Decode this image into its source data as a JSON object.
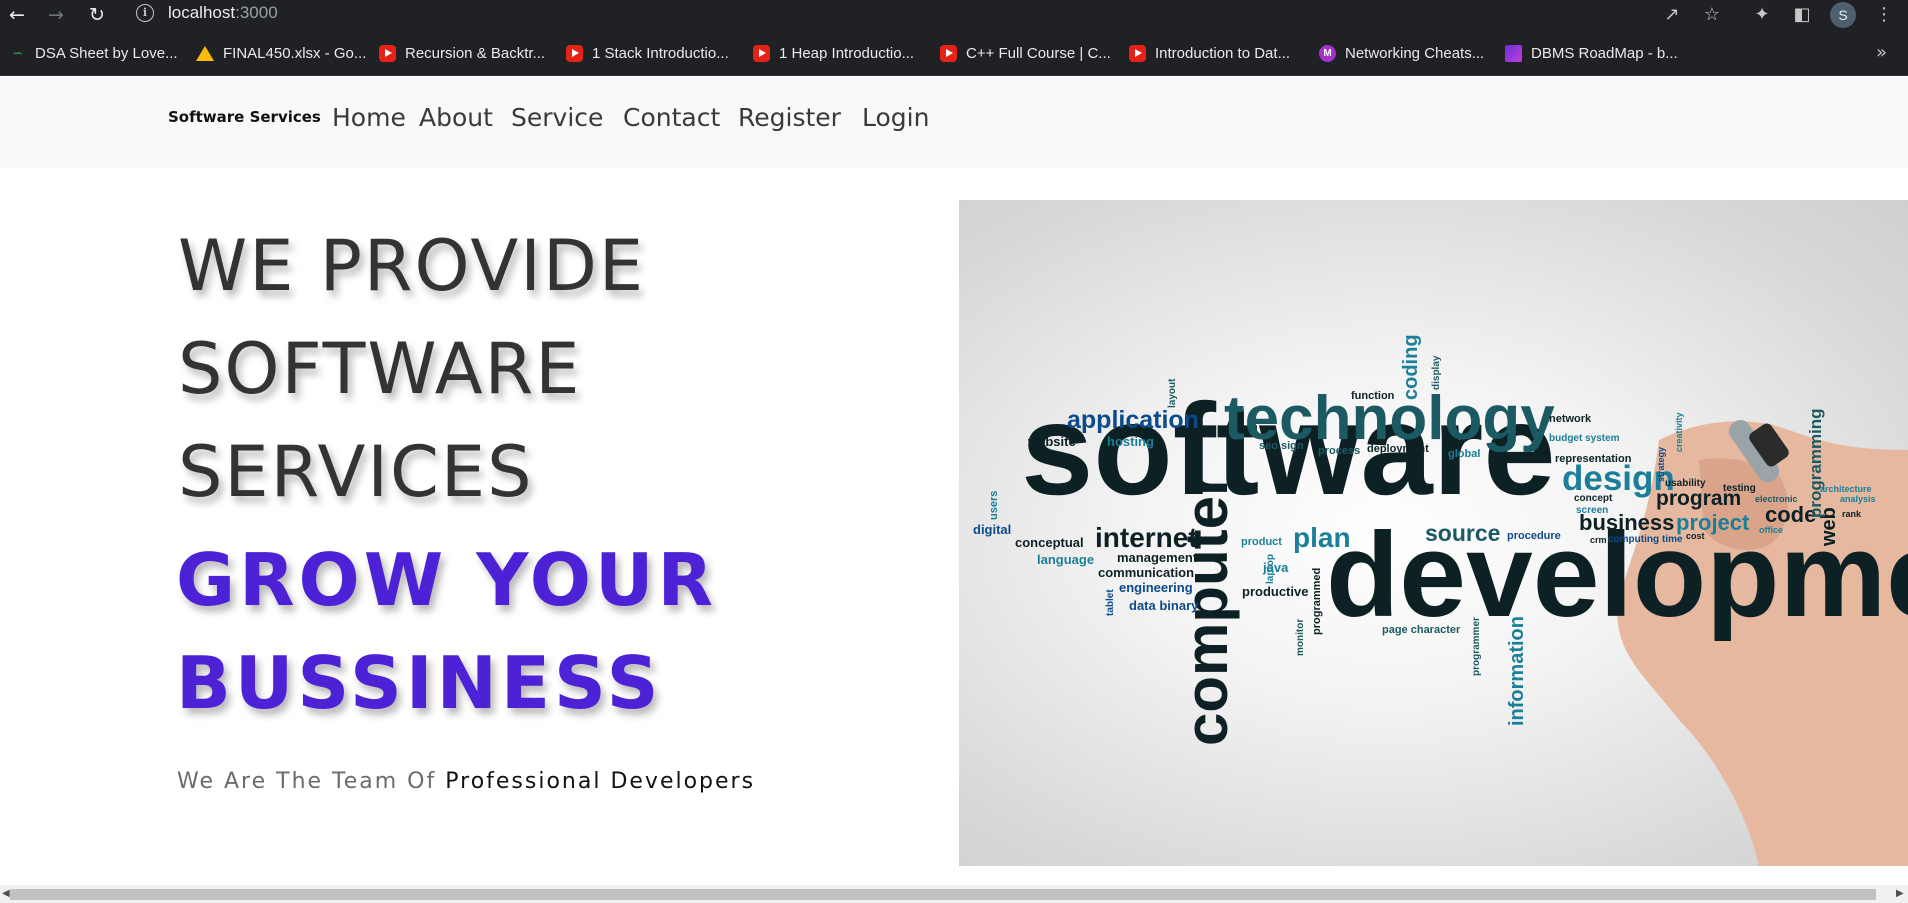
{
  "browser": {
    "url_host": "localhost",
    "url_port": ":3000",
    "profile_initial": "S",
    "bookmarks": [
      {
        "label": "DSA Sheet by Love...",
        "icon": "gfg-icon"
      },
      {
        "label": "FINAL450.xlsx - Go...",
        "icon": "google-drive-icon"
      },
      {
        "label": "Recursion & Backtr...",
        "icon": "youtube-icon"
      },
      {
        "label": "1 Stack Introductio...",
        "icon": "youtube-icon"
      },
      {
        "label": "1 Heap Introductio...",
        "icon": "youtube-icon"
      },
      {
        "label": "C++ Full Course | C...",
        "icon": "youtube-icon"
      },
      {
        "label": "Introduction to Dat...",
        "icon": "youtube-icon"
      },
      {
        "label": "Networking Cheats...",
        "icon": "medium-icon"
      },
      {
        "label": "DBMS RoadMap - b...",
        "icon": "dbms-icon"
      }
    ]
  },
  "site": {
    "brand": "Software Services",
    "nav": [
      "Home",
      "About",
      "Service",
      "Contact",
      "Register",
      "Login"
    ],
    "hero": {
      "line1": "WE PROVIDE",
      "line2": "SOFTWARE",
      "line3": "SERVICES",
      "accent1": "GROW YOUR",
      "accent2": "BUSSINESS",
      "tagline_prefix": "We Are The Team Of ",
      "tagline_strong": "Professional Developers"
    },
    "word_cloud": {
      "software": "software",
      "development": "developmen",
      "technology": "technology",
      "computer": "computer",
      "application": "application",
      "design": "design",
      "internet": "internet",
      "plan": "plan",
      "source": "source",
      "business": "business",
      "project": "project",
      "program": "program",
      "code": "code",
      "web": "web",
      "programming": "programming",
      "information": "information",
      "coding": "coding",
      "website": "website",
      "hosting": "hosting",
      "digital": "digital",
      "conceptual": "conceptual",
      "language": "language",
      "management": "management",
      "communication": "communication",
      "engineering": "engineering",
      "data_binary": "data binary",
      "productive": "productive",
      "programmed": "programmed",
      "java": "java",
      "product": "product",
      "page_character": "page character",
      "function": "function",
      "network": "network",
      "budget_system": "budget  system",
      "representation": "representation",
      "seo_sign": "seo  sign",
      "process": "process",
      "deployment": "deployment",
      "global": "global",
      "procedure": "procedure",
      "concept": "concept",
      "screen": "screen",
      "computing": "computing",
      "time": "time",
      "layout": "layout",
      "display": "display",
      "users": "users",
      "laptop": "laptop",
      "tablet": "tablet",
      "monitor": "monitor",
      "programmer": "programmer",
      "usability": "usability",
      "testing": "testing",
      "architecture": "architecture",
      "analysis": "analysis",
      "electronic": "electronic",
      "rank": "rank",
      "crm": "crm",
      "cost": "cost",
      "office": "office",
      "strategy": "strategy",
      "creativity": "creativity"
    }
  }
}
